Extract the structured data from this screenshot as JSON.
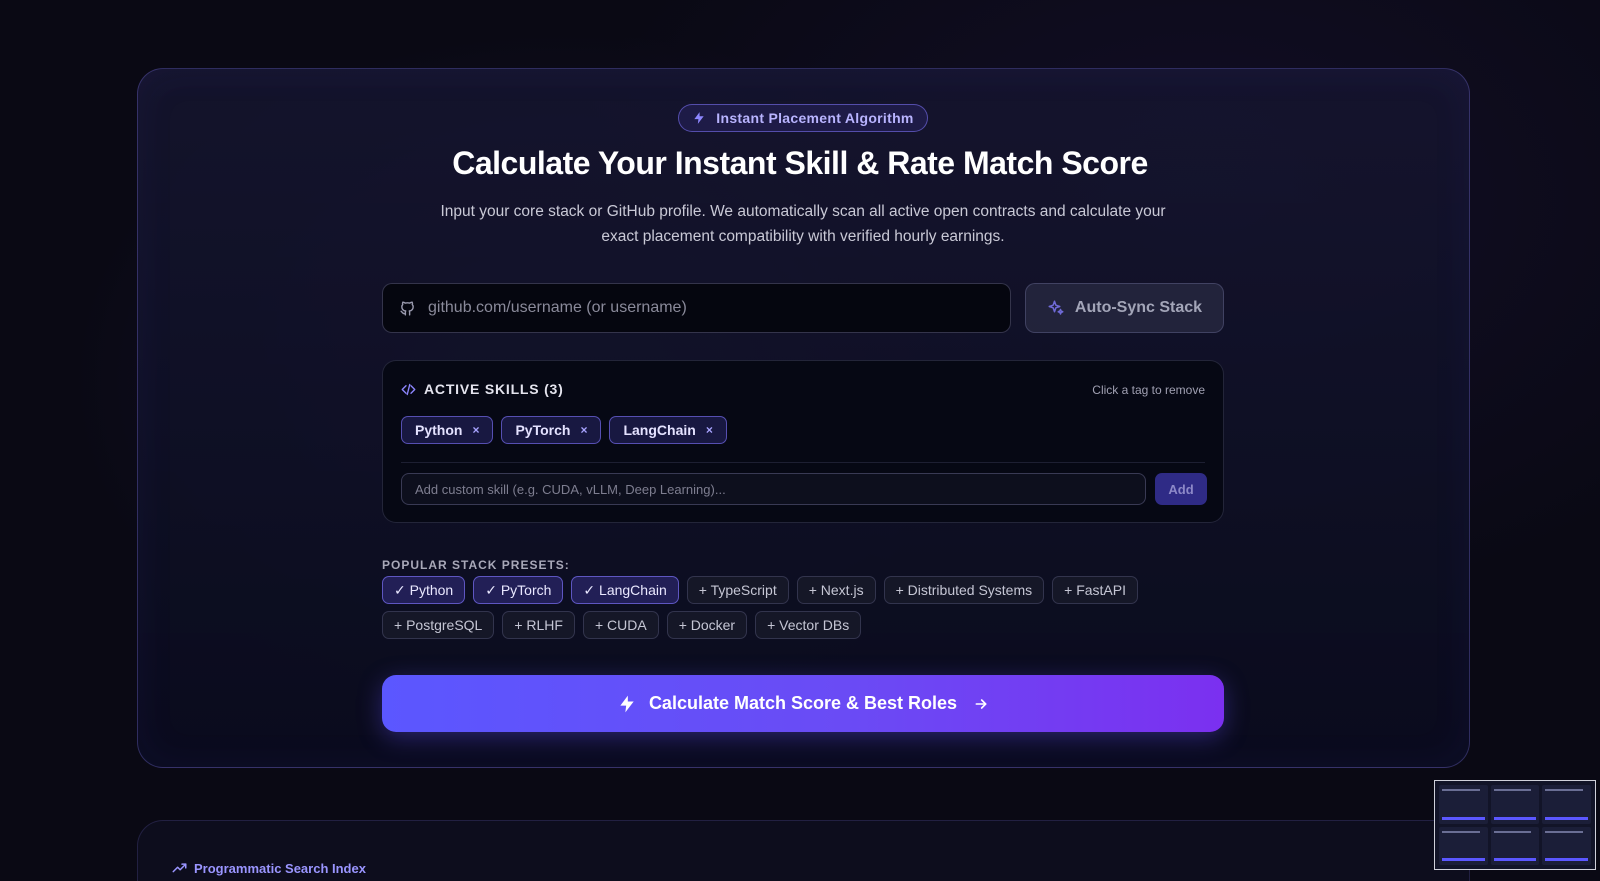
{
  "badge": {
    "label": "Instant Placement Algorithm"
  },
  "hero": {
    "title": "Calculate Your Instant Skill & Rate Match Score",
    "subtitle": "Input your core stack or GitHub profile. We automatically scan all active open contracts and calculate your exact placement compatibility with verified hourly earnings."
  },
  "github": {
    "placeholder": "github.com/username (or username)",
    "value": ""
  },
  "sync_button": {
    "label": "Auto-Sync Stack"
  },
  "skills": {
    "heading": "ACTIVE SKILLS (3)",
    "hint": "Click a tag to remove",
    "tags": [
      {
        "label": "Python"
      },
      {
        "label": "PyTorch"
      },
      {
        "label": "LangChain"
      }
    ],
    "remove_glyph": "×",
    "custom_placeholder": "Add custom skill (e.g. CUDA, vLLM, Deep Learning)...",
    "add_label": "Add"
  },
  "presets": {
    "label": "POPULAR STACK PRESETS:",
    "items": [
      {
        "label": "✓ Python",
        "active": true
      },
      {
        "label": "✓ PyTorch",
        "active": true
      },
      {
        "label": "✓ LangChain",
        "active": true
      },
      {
        "label": "+ TypeScript",
        "active": false
      },
      {
        "label": "+ Next.js",
        "active": false
      },
      {
        "label": "+ Distributed Systems",
        "active": false
      },
      {
        "label": "+ FastAPI",
        "active": false
      },
      {
        "label": "+ PostgreSQL",
        "active": false
      },
      {
        "label": "+ RLHF",
        "active": false
      },
      {
        "label": "+ CUDA",
        "active": false
      },
      {
        "label": "+ Docker",
        "active": false
      },
      {
        "label": "+ Vector DBs",
        "active": false
      }
    ]
  },
  "cta": {
    "label": "Calculate Match Score & Best Roles"
  },
  "next_section": {
    "label": "Programmatic Search Index"
  },
  "colors": {
    "accent": "#5b57ff",
    "accent_end": "#7b30f0",
    "background": "#0a0914",
    "chip_active": "#3c3696"
  }
}
